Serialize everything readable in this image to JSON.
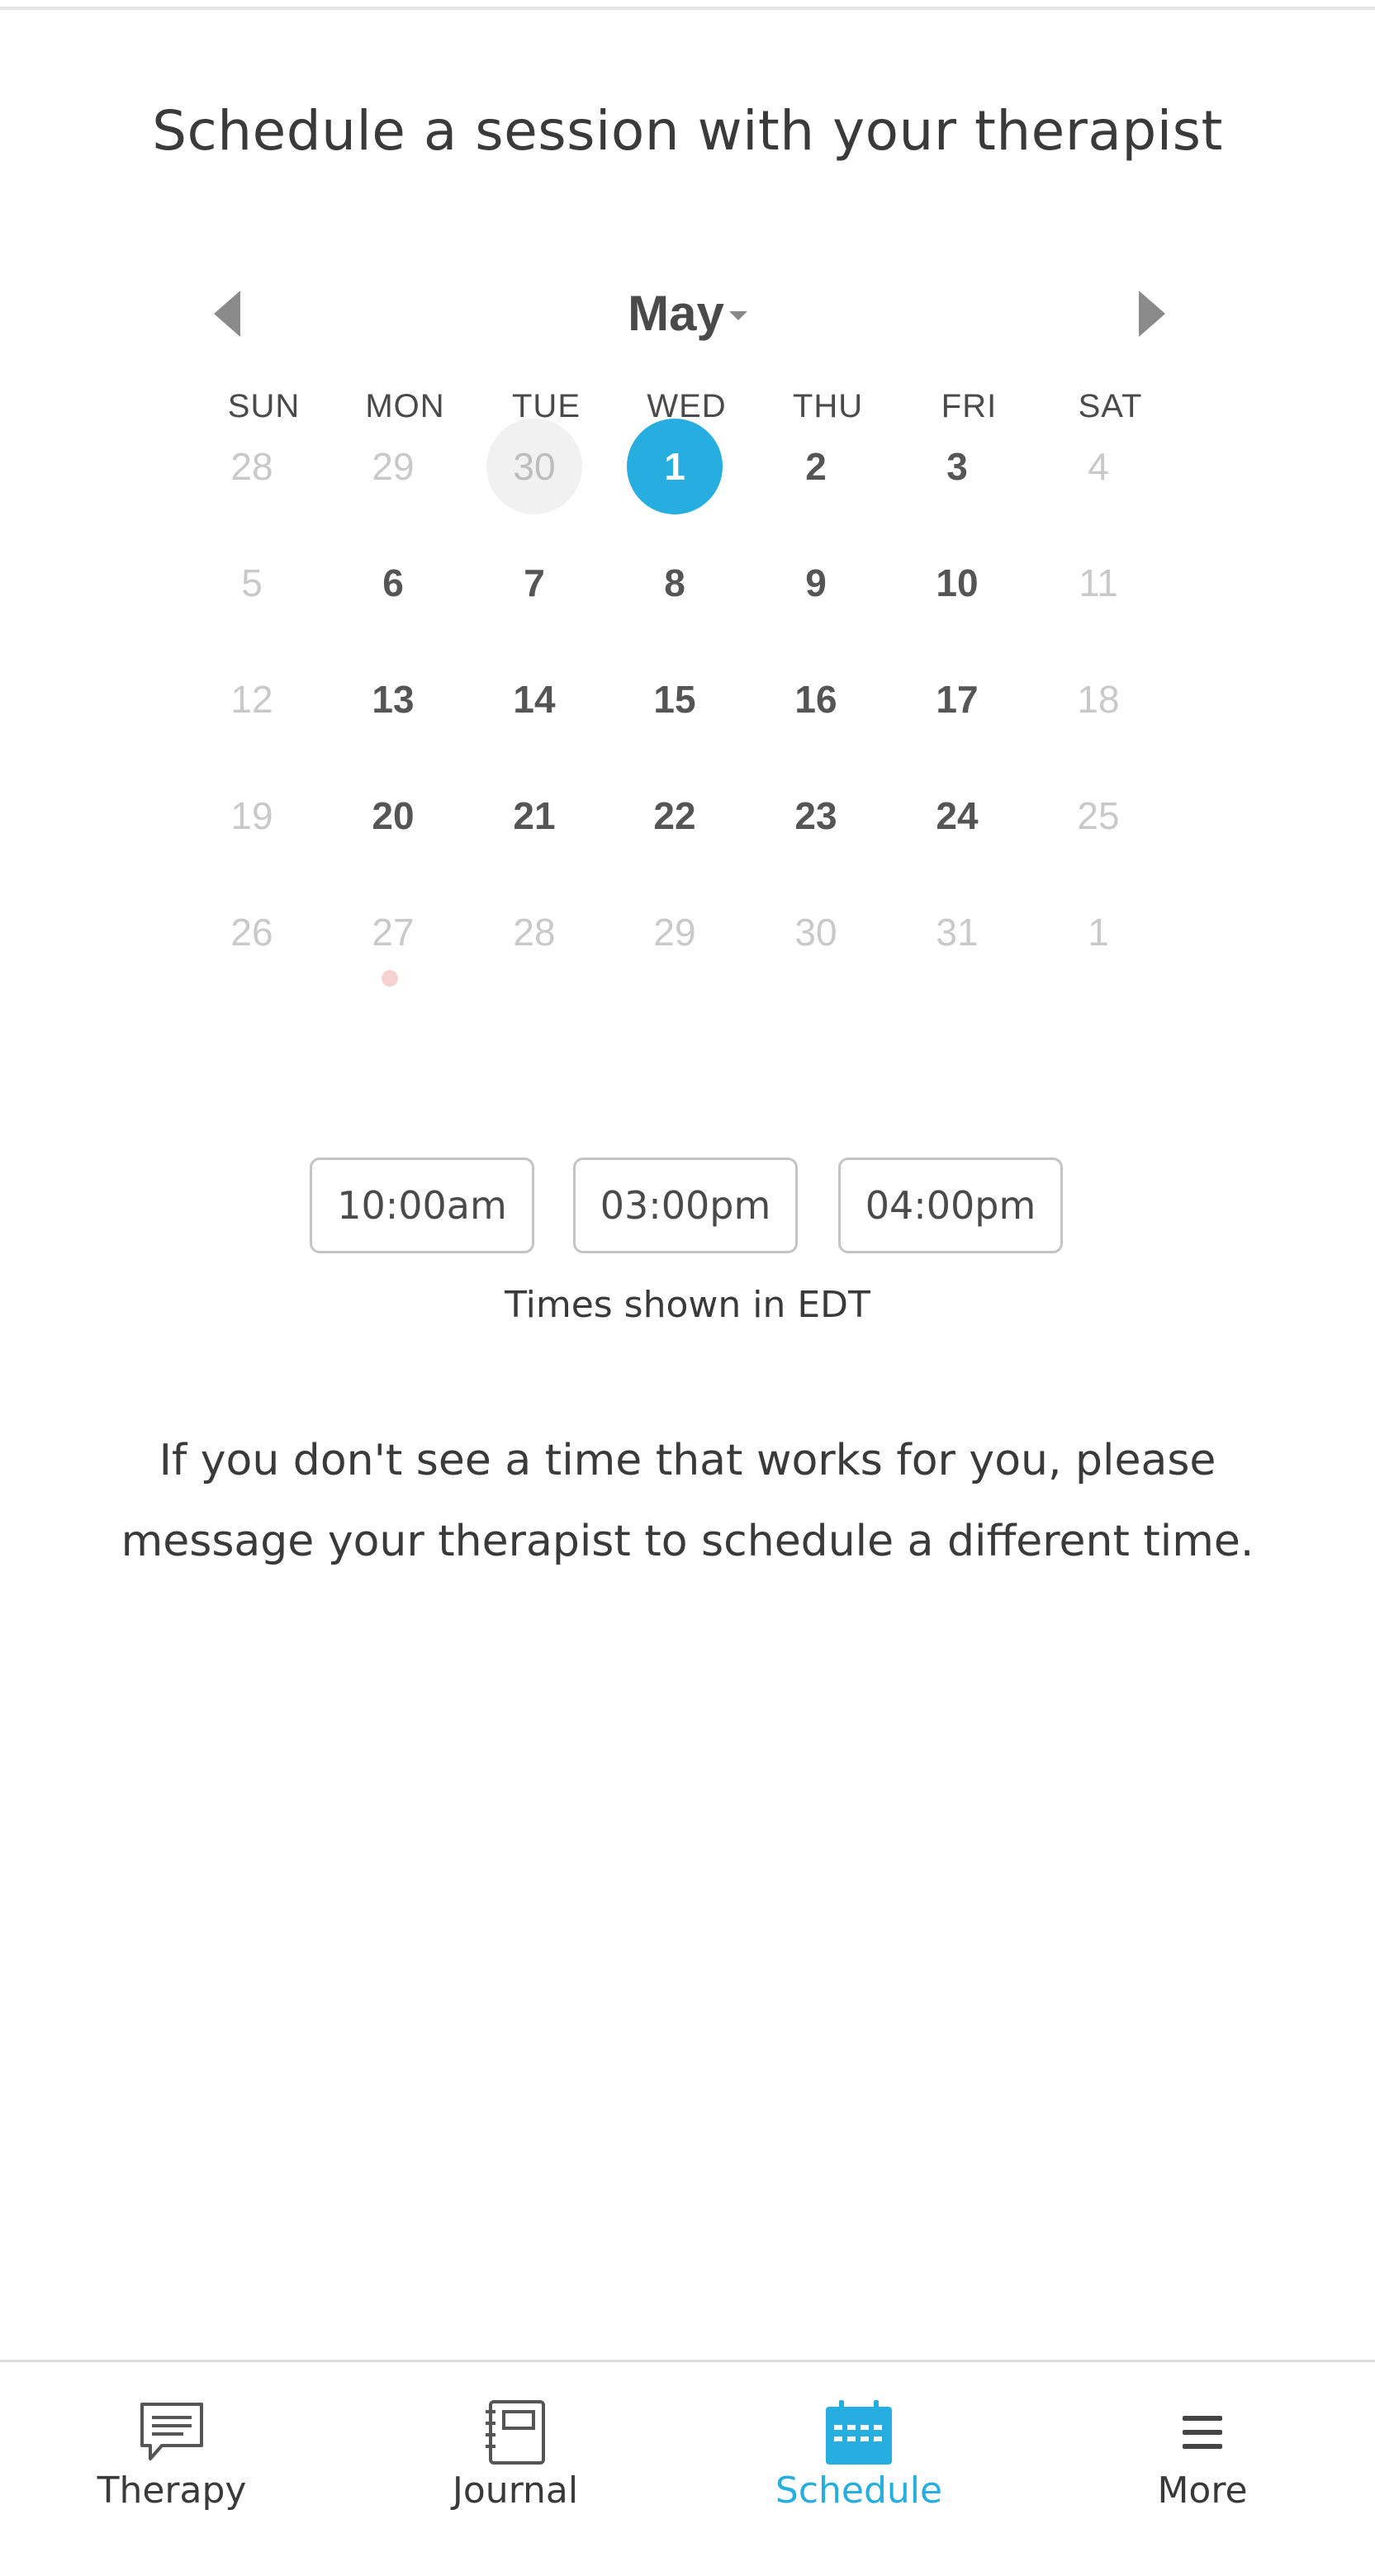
{
  "page": {
    "title": "Schedule a session with your therapist"
  },
  "calendar": {
    "month": "May",
    "weekdays": [
      "SUN",
      "MON",
      "TUE",
      "WED",
      "THU",
      "FRI",
      "SAT"
    ],
    "weeks": [
      [
        {
          "d": "28",
          "s": "muted"
        },
        {
          "d": "29",
          "s": "muted"
        },
        {
          "d": "30",
          "s": "today"
        },
        {
          "d": "1",
          "s": "selected"
        },
        {
          "d": "2",
          "s": "active"
        },
        {
          "d": "3",
          "s": "active"
        },
        {
          "d": "4",
          "s": "muted"
        }
      ],
      [
        {
          "d": "5",
          "s": "muted"
        },
        {
          "d": "6",
          "s": "active"
        },
        {
          "d": "7",
          "s": "active"
        },
        {
          "d": "8",
          "s": "active"
        },
        {
          "d": "9",
          "s": "active"
        },
        {
          "d": "10",
          "s": "active"
        },
        {
          "d": "11",
          "s": "muted"
        }
      ],
      [
        {
          "d": "12",
          "s": "muted"
        },
        {
          "d": "13",
          "s": "active"
        },
        {
          "d": "14",
          "s": "active"
        },
        {
          "d": "15",
          "s": "active"
        },
        {
          "d": "16",
          "s": "active"
        },
        {
          "d": "17",
          "s": "active"
        },
        {
          "d": "18",
          "s": "muted"
        }
      ],
      [
        {
          "d": "19",
          "s": "muted"
        },
        {
          "d": "20",
          "s": "active"
        },
        {
          "d": "21",
          "s": "active"
        },
        {
          "d": "22",
          "s": "active"
        },
        {
          "d": "23",
          "s": "active"
        },
        {
          "d": "24",
          "s": "active"
        },
        {
          "d": "25",
          "s": "muted"
        }
      ],
      [
        {
          "d": "26",
          "s": "muted"
        },
        {
          "d": "27",
          "s": "muted",
          "dot": true
        },
        {
          "d": "28",
          "s": "muted"
        },
        {
          "d": "29",
          "s": "muted"
        },
        {
          "d": "30",
          "s": "muted"
        },
        {
          "d": "31",
          "s": "muted"
        },
        {
          "d": "1",
          "s": "muted"
        }
      ]
    ],
    "colors": {
      "selected": "#27aee0",
      "today_bg": "#f1f1f1",
      "dot": "#f7d2d2"
    }
  },
  "time_slots": [
    "10:00am",
    "03:00pm",
    "04:00pm"
  ],
  "timezone_note": "Times shown in EDT",
  "help_text": "If you don't see a time that works for you, please message your therapist to schedule a different time.",
  "bottom_nav": {
    "items": [
      {
        "label": "Therapy",
        "icon": "chat-bubble-icon"
      },
      {
        "label": "Journal",
        "icon": "notebook-icon"
      },
      {
        "label": "Schedule",
        "icon": "calendar-icon",
        "active": true
      },
      {
        "label": "More",
        "icon": "hamburger-menu-icon"
      }
    ],
    "active_color": "#27aee0"
  }
}
